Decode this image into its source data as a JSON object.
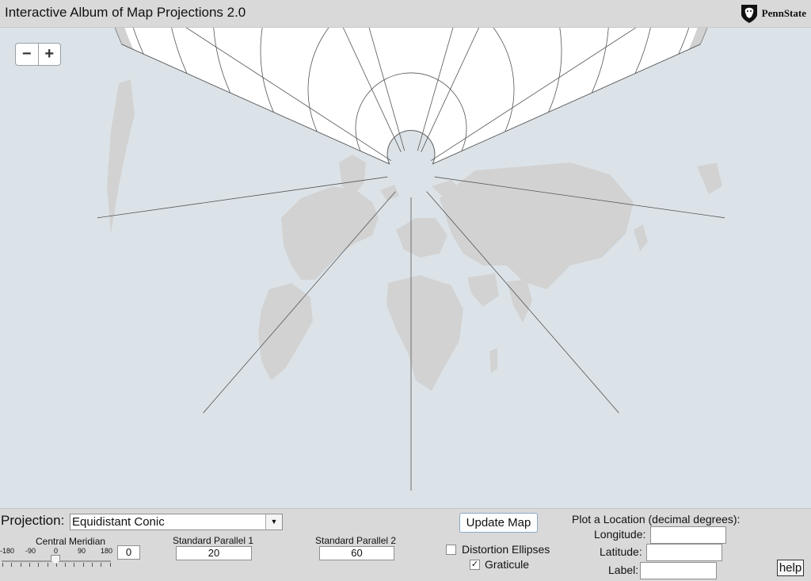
{
  "header": {
    "title": "Interactive Album of Map Projections 2.0",
    "logo_text": "PennState"
  },
  "map": {
    "zoom_out_label": "−",
    "zoom_in_label": "+",
    "colors": {
      "ocean": "#ffffff",
      "land": "#d2d2d2",
      "background": "#dce3e8",
      "graticule": "#555555"
    }
  },
  "controls": {
    "projection_label": "Projection:",
    "projection_value": "Equidistant Conic",
    "central_meridian_label": "Central Meridian",
    "central_meridian_ticks": [
      "-180",
      "-90",
      "0",
      "90",
      "180"
    ],
    "central_meridian_value": "0",
    "sp1_label": "Standard Parallel 1",
    "sp1_value": "20",
    "sp2_label": "Standard Parallel 2",
    "sp2_value": "60",
    "update_button": "Update Map",
    "distortion_label": "Distortion Ellipses",
    "distortion_checked": false,
    "graticule_label": "Graticule",
    "graticule_checked": true,
    "plot_title": "Plot a Location (decimal degrees):",
    "longitude_label": "Longitude:",
    "latitude_label": "Latitude:",
    "label_label": "Label:",
    "longitude_value": "",
    "latitude_value": "",
    "label_value": "",
    "help_button": "help"
  }
}
